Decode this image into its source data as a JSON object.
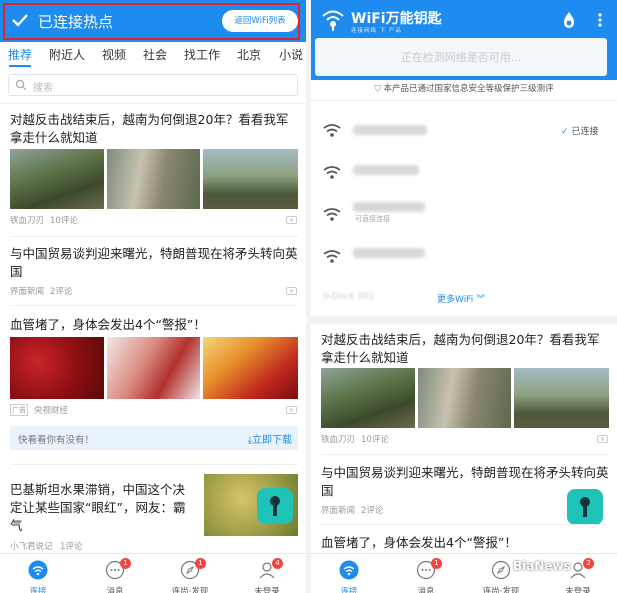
{
  "left": {
    "status_title": "已连接热点",
    "back_button": "返回WiFi列表",
    "tabs": [
      "推荐",
      "附近人",
      "视频",
      "社会",
      "找工作",
      "北京",
      "小说"
    ],
    "search_placeholder": "搜索",
    "news": [
      {
        "title": "对越反击战结束后，越南为何倒退20年？看看我军拿走什么就知道",
        "source": "铁血刀刃",
        "comments": "10评论"
      },
      {
        "title": "与中国贸易谈判迎来曙光，特朗普现在将矛头转向英国",
        "source": "界面新闻",
        "comments": "2评论"
      },
      {
        "title": "血管堵了，身体会发出4个“警报”！",
        "ad_tag": "广告",
        "source": "央视财经"
      },
      {
        "title": "巴基斯坦水果滞销，中国这个决定让某些国家“眼红”，网友：霸气",
        "source": "小飞君说记",
        "comments": "1评论"
      }
    ],
    "download_prompt": "快看看你有没有！",
    "download_button": "立即下载",
    "nav": [
      {
        "label": "连接",
        "badge": ""
      },
      {
        "label": "消息",
        "badge": "1"
      },
      {
        "label": "连尚·发现",
        "badge": "1"
      },
      {
        "label": "未登录",
        "badge": "4"
      }
    ]
  },
  "right": {
    "app_name": "WiFi万能钥匙",
    "app_slogan": "连接网络 下 产品",
    "detecting_text": "正在检测网络是否可用...",
    "security_notice": "本产品已通过国家信息安全等级保护三级测评",
    "connected_label": "已连接",
    "wifi_sub_label": "可直接连接",
    "faded_network": "0-Dock 001",
    "more_wifi": "更多WiFi",
    "news": [
      {
        "title": "对越反击战结束后，越南为何倒退20年？看看我军拿走什么就知道",
        "source": "铁血刀刃",
        "comments": "10评论"
      },
      {
        "title": "与中国贸易谈判迎来曙光，特朗普现在将矛头转向英国",
        "source": "界面新闻",
        "comments": "2评论"
      },
      {
        "title": "血管堵了，身体会发出4个“警报”！"
      }
    ],
    "nav": [
      {
        "label": "连接",
        "badge": ""
      },
      {
        "label": "消息",
        "badge": "1"
      },
      {
        "label": "连尚·发现",
        "badge": ""
      },
      {
        "label": "未登录",
        "badge": "2"
      }
    ]
  },
  "watermark": "BiaNews",
  "colors": {
    "brand_blue": "#1e8bf0",
    "highlight_red": "#e6212b",
    "badge_red": "#f2453d"
  }
}
